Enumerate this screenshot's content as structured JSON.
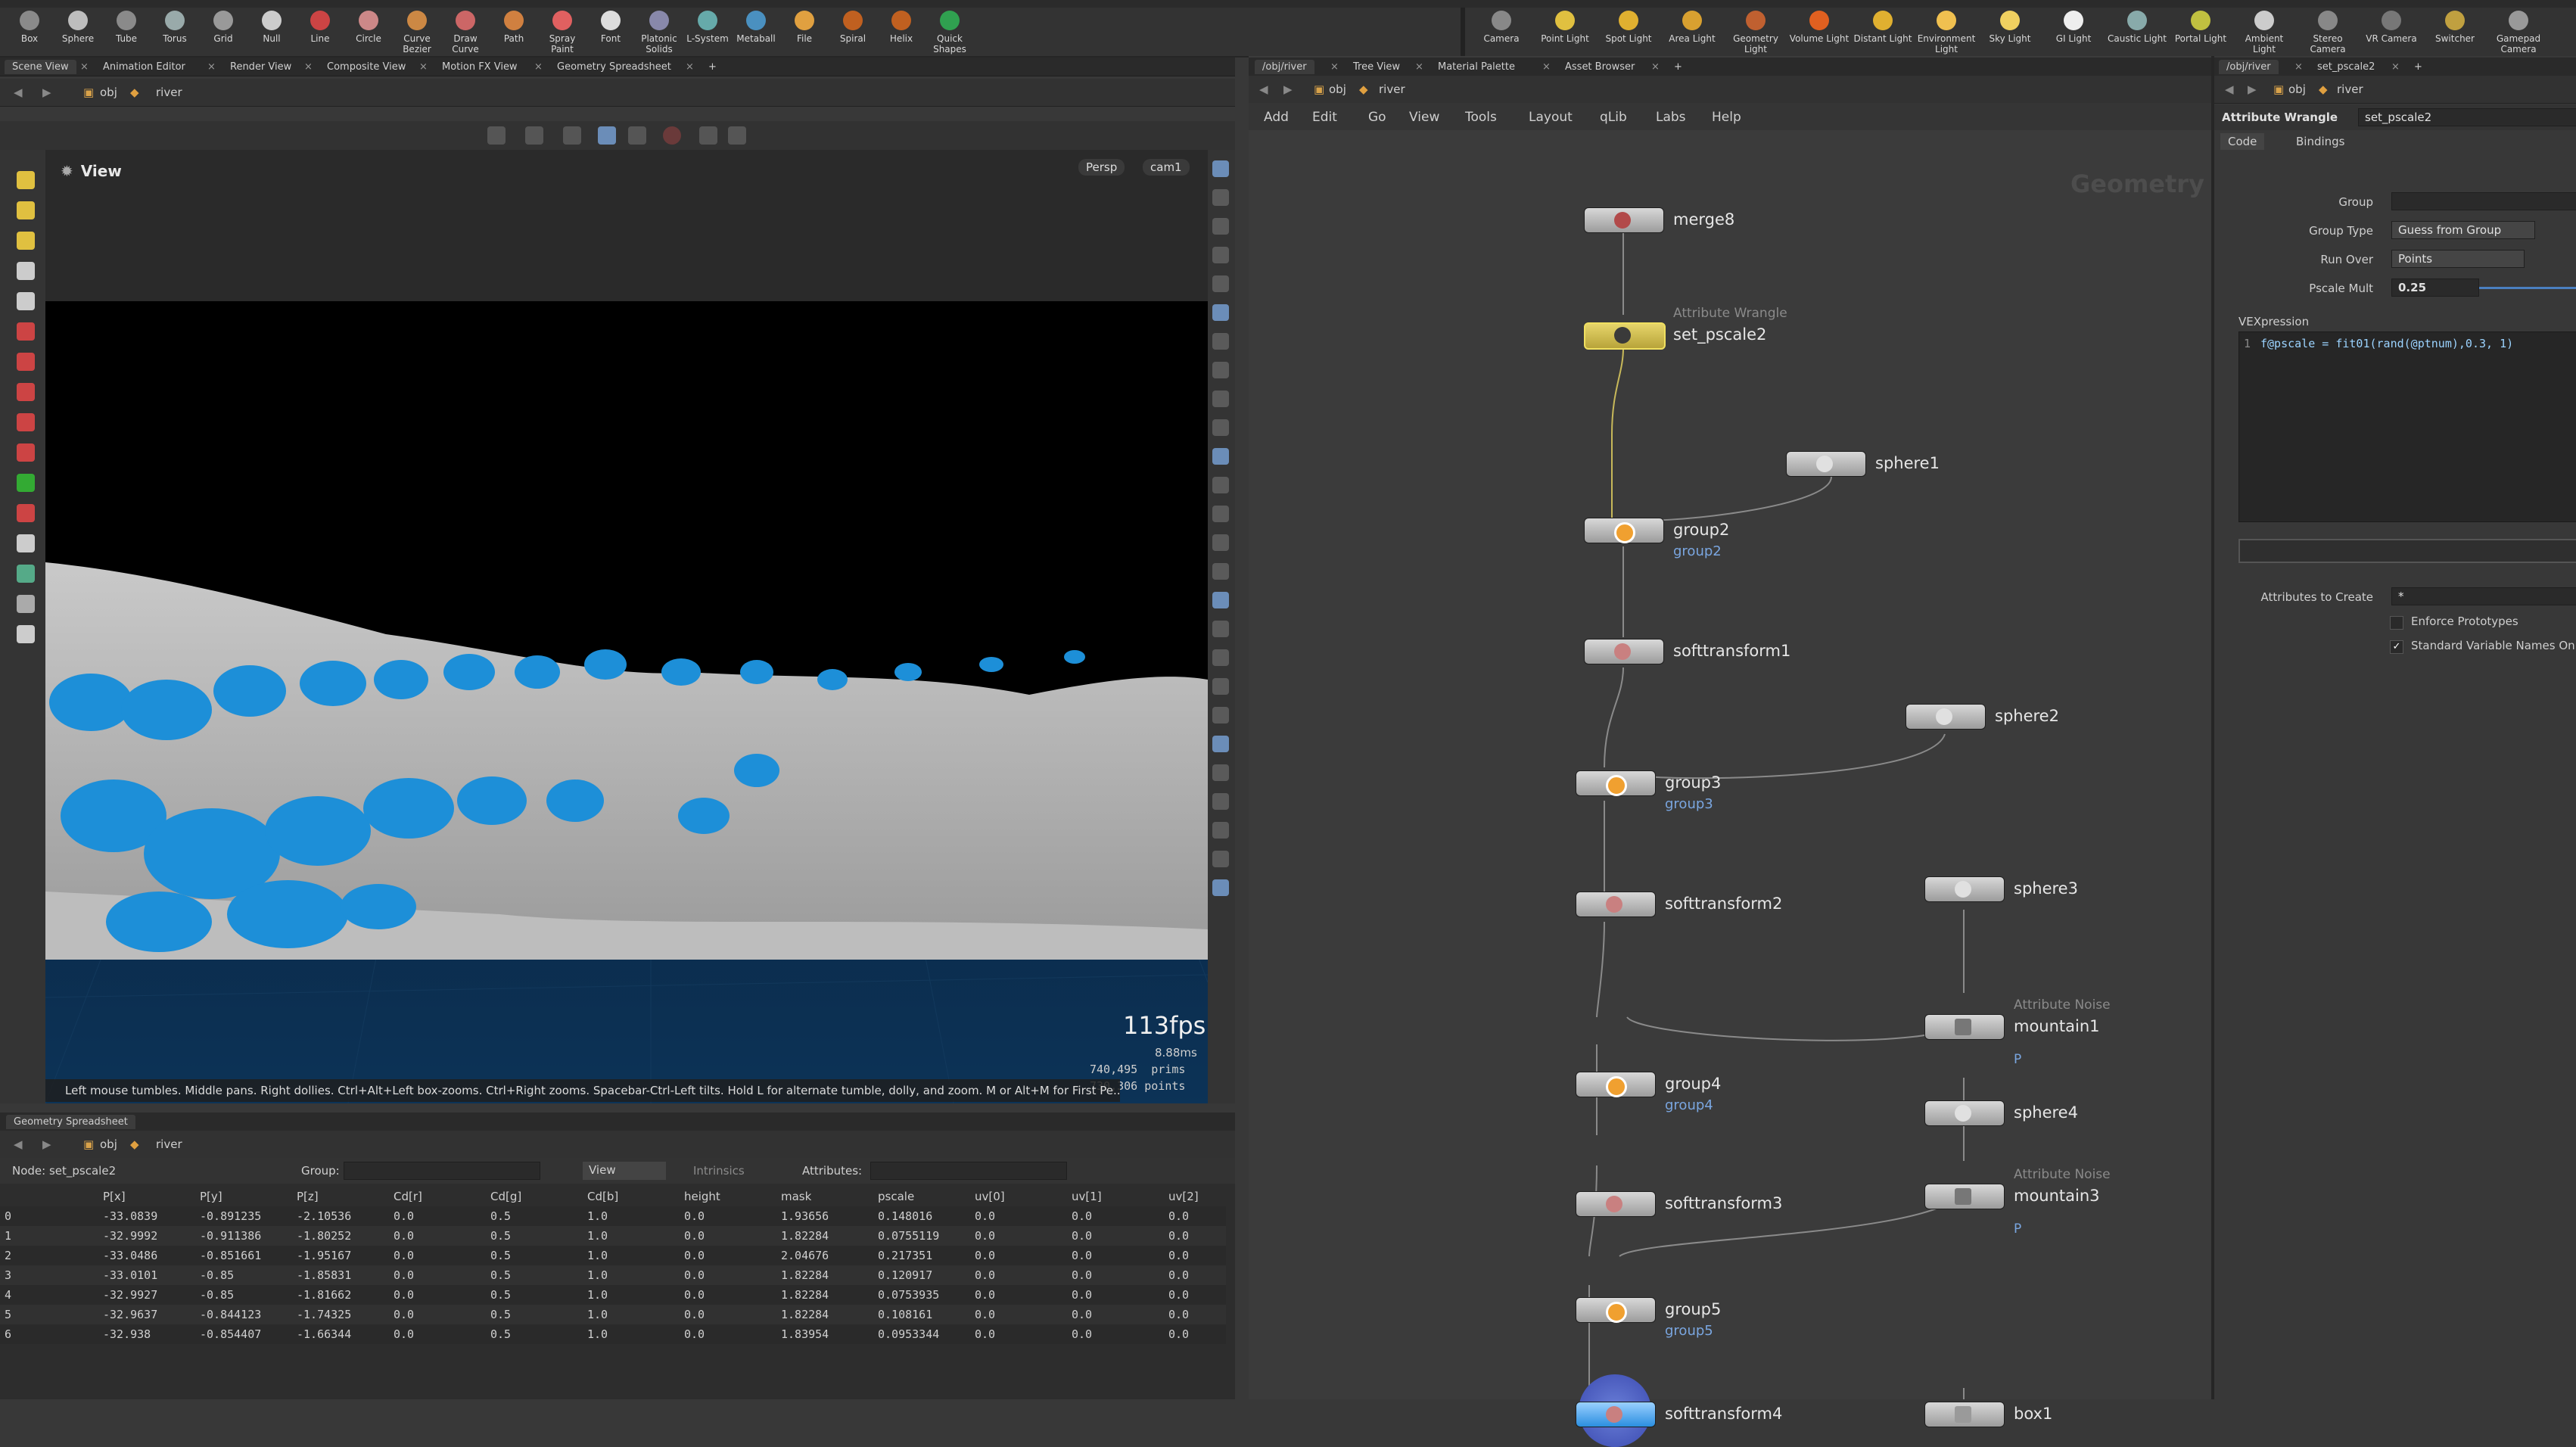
{
  "shelf_left": [
    "Box",
    "Sphere",
    "Tube",
    "Torus",
    "Grid",
    "Null",
    "Line",
    "Circle",
    "Curve Bezier",
    "Draw Curve",
    "Path",
    "Spray Paint",
    "Font",
    "Platonic Solids",
    "L-System",
    "Metaball",
    "File",
    "Spiral",
    "Helix",
    "Quick Shapes"
  ],
  "shelf_right": [
    "Camera",
    "Point Light",
    "Spot Light",
    "Area Light",
    "Geometry Light",
    "Volume Light",
    "Distant Light",
    "Environment Light",
    "Sky Light",
    "GI Light",
    "Caustic Light",
    "Portal Light",
    "Ambient Light",
    "Stereo Camera",
    "VR Camera",
    "Switcher",
    "Gamepad Camera"
  ],
  "left_tabs": [
    "Scene View",
    "Animation Editor",
    "Render View",
    "Composite View",
    "Motion FX View",
    "Geometry Spreadsheet"
  ],
  "mid_tabs": [
    "/obj/river",
    "Tree View",
    "Material Palette",
    "Asset Browser"
  ],
  "right_tabs": [
    "/obj/river",
    "set_pscale2"
  ],
  "path": {
    "obj": "obj",
    "river": "river"
  },
  "viewport": {
    "title": "View",
    "persp": "Persp",
    "cam": "cam1",
    "fps": "113fps",
    "ms": "8.88ms",
    "prims_num": "740,495",
    "prims": "prims",
    "points_num": "730,306",
    "points": "points",
    "status": "Left mouse tumbles. Middle pans. Right dollies. Ctrl+Alt+Left box-zooms. Ctrl+Right zooms. Spacebar-Ctrl-Left tilts. Hold L for alternate tumble, dolly, and zoom. M or Alt+M for First Pe..."
  },
  "spreadsheet": {
    "tab": "Geometry Spreadsheet",
    "node_label": "Node: set_pscale2",
    "group_label": "Group:",
    "view_label": "View",
    "intrinsics": "Intrinsics",
    "attributes_label": "Attributes:",
    "columns": [
      "",
      "P[x]",
      "P[y]",
      "P[z]",
      "Cd[r]",
      "Cd[g]",
      "Cd[b]",
      "height",
      "mask",
      "pscale",
      "uv[0]",
      "uv[1]",
      "uv[2]"
    ],
    "rows": [
      [
        "0",
        "-33.0839",
        "-0.891235",
        "-2.10536",
        "0.0",
        "0.5",
        "1.0",
        "0.0",
        "1.93656",
        "0.148016",
        "0.0",
        "0.0",
        "0.0"
      ],
      [
        "1",
        "-32.9992",
        "-0.911386",
        "-1.80252",
        "0.0",
        "0.5",
        "1.0",
        "0.0",
        "1.82284",
        "0.0755119",
        "0.0",
        "0.0",
        "0.0"
      ],
      [
        "2",
        "-33.0486",
        "-0.851661",
        "-1.95167",
        "0.0",
        "0.5",
        "1.0",
        "0.0",
        "2.04676",
        "0.217351",
        "0.0",
        "0.0",
        "0.0"
      ],
      [
        "3",
        "-33.0101",
        "-0.85",
        "-1.85831",
        "0.0",
        "0.5",
        "1.0",
        "0.0",
        "1.82284",
        "0.120917",
        "0.0",
        "0.0",
        "0.0"
      ],
      [
        "4",
        "-32.9927",
        "-0.85",
        "-1.81662",
        "0.0",
        "0.5",
        "1.0",
        "0.0",
        "1.82284",
        "0.0753935",
        "0.0",
        "0.0",
        "0.0"
      ],
      [
        "5",
        "-32.9637",
        "-0.844123",
        "-1.74325",
        "0.0",
        "0.5",
        "1.0",
        "0.0",
        "1.82284",
        "0.108161",
        "0.0",
        "0.0",
        "0.0"
      ],
      [
        "6",
        "-32.938",
        "-0.854407",
        "-1.66344",
        "0.0",
        "0.5",
        "1.0",
        "0.0",
        "1.83954",
        "0.0953344",
        "0.0",
        "0.0",
        "0.0"
      ]
    ]
  },
  "network": {
    "menu": [
      "Add",
      "Edit",
      "Go",
      "View",
      "Tools",
      "Layout",
      "qLib",
      "Labs",
      "Help"
    ],
    "context": "Geometry",
    "nodes": {
      "merge8": "merge8",
      "wrangle_type": "Attribute Wrangle",
      "set_pscale2": "set_pscale2",
      "sphere1": "sphere1",
      "group2": "group2",
      "group2_grp": "group2",
      "softtransform1": "softtransform1",
      "sphere2": "sphere2",
      "group3": "group3",
      "group3_grp": "group3",
      "softtransform2": "softtransform2",
      "sphere3": "sphere3",
      "noise_type1": "Attribute Noise",
      "mountain1": "mountain1",
      "mountain1_p": "P",
      "group4": "group4",
      "group4_grp": "group4",
      "sphere4": "sphere4",
      "softtransform3": "softtransform3",
      "noise_type3": "Attribute Noise",
      "mountain3": "mountain3",
      "mountain3_p": "P",
      "group5": "group5",
      "group5_grp": "group5",
      "softtransform4": "softtransform4",
      "box1": "box1"
    }
  },
  "params": {
    "type": "Attribute Wrangle",
    "name": "set_pscale2",
    "tabs": [
      "Code",
      "Bindings"
    ],
    "group_label": "Group",
    "group_value": "",
    "group_type_label": "Group Type",
    "group_type_value": "Guess from Group",
    "run_over_label": "Run Over",
    "run_over_value": "Points",
    "pscale_mult_label": "Pscale Mult",
    "pscale_mult_value": "0.25",
    "vex_label": "VEXpression",
    "vex_line": "1",
    "vex_code": "f@pscale = fit01(rand(@ptnum),0.3, 1)",
    "attrs_label": "Attributes to Create",
    "attrs_value": "*",
    "enforce": "Enforce Prototypes",
    "standard": "Standard Variable Names On"
  }
}
